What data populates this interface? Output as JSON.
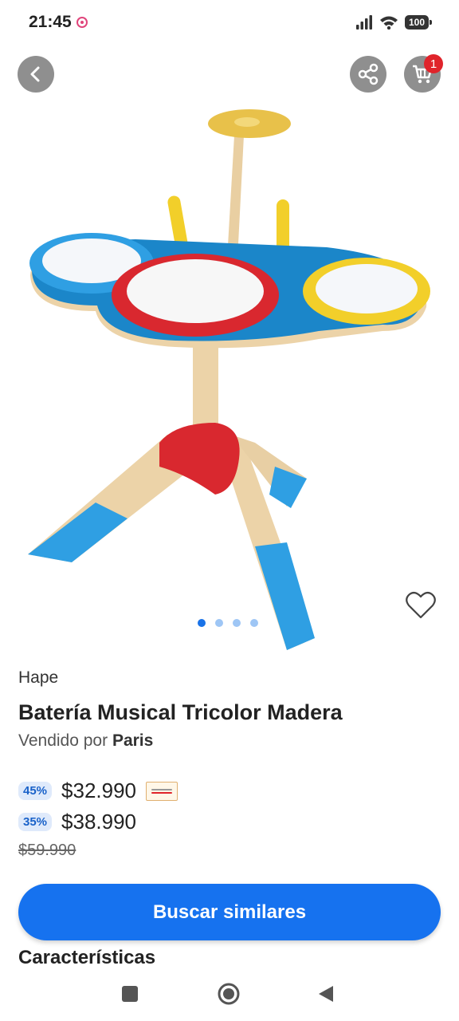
{
  "status_bar": {
    "time": "21:45",
    "battery": "100"
  },
  "header": {
    "back_icon": "chevron-left-icon",
    "share_icon": "share-icon",
    "cart_icon": "cart-icon",
    "cart_count": "1"
  },
  "gallery": {
    "total_images": 4,
    "active_index": 0
  },
  "product": {
    "brand": "Hape",
    "title": "Batería Musical Tricolor Madera",
    "sold_by_prefix": "Vendido por",
    "seller": "Paris"
  },
  "prices": [
    {
      "discount": "45%",
      "price": "$32.990",
      "card_logo": true
    },
    {
      "discount": "35%",
      "price": "$38.990"
    }
  ],
  "old_price": "$59.990",
  "actions": {
    "primary_button": "Buscar similares"
  },
  "sections": {
    "characteristics_title": "Características"
  },
  "colors": {
    "primary": "#1672ef",
    "badge": "#e0242b",
    "discount_bg": "#dfeafb"
  }
}
